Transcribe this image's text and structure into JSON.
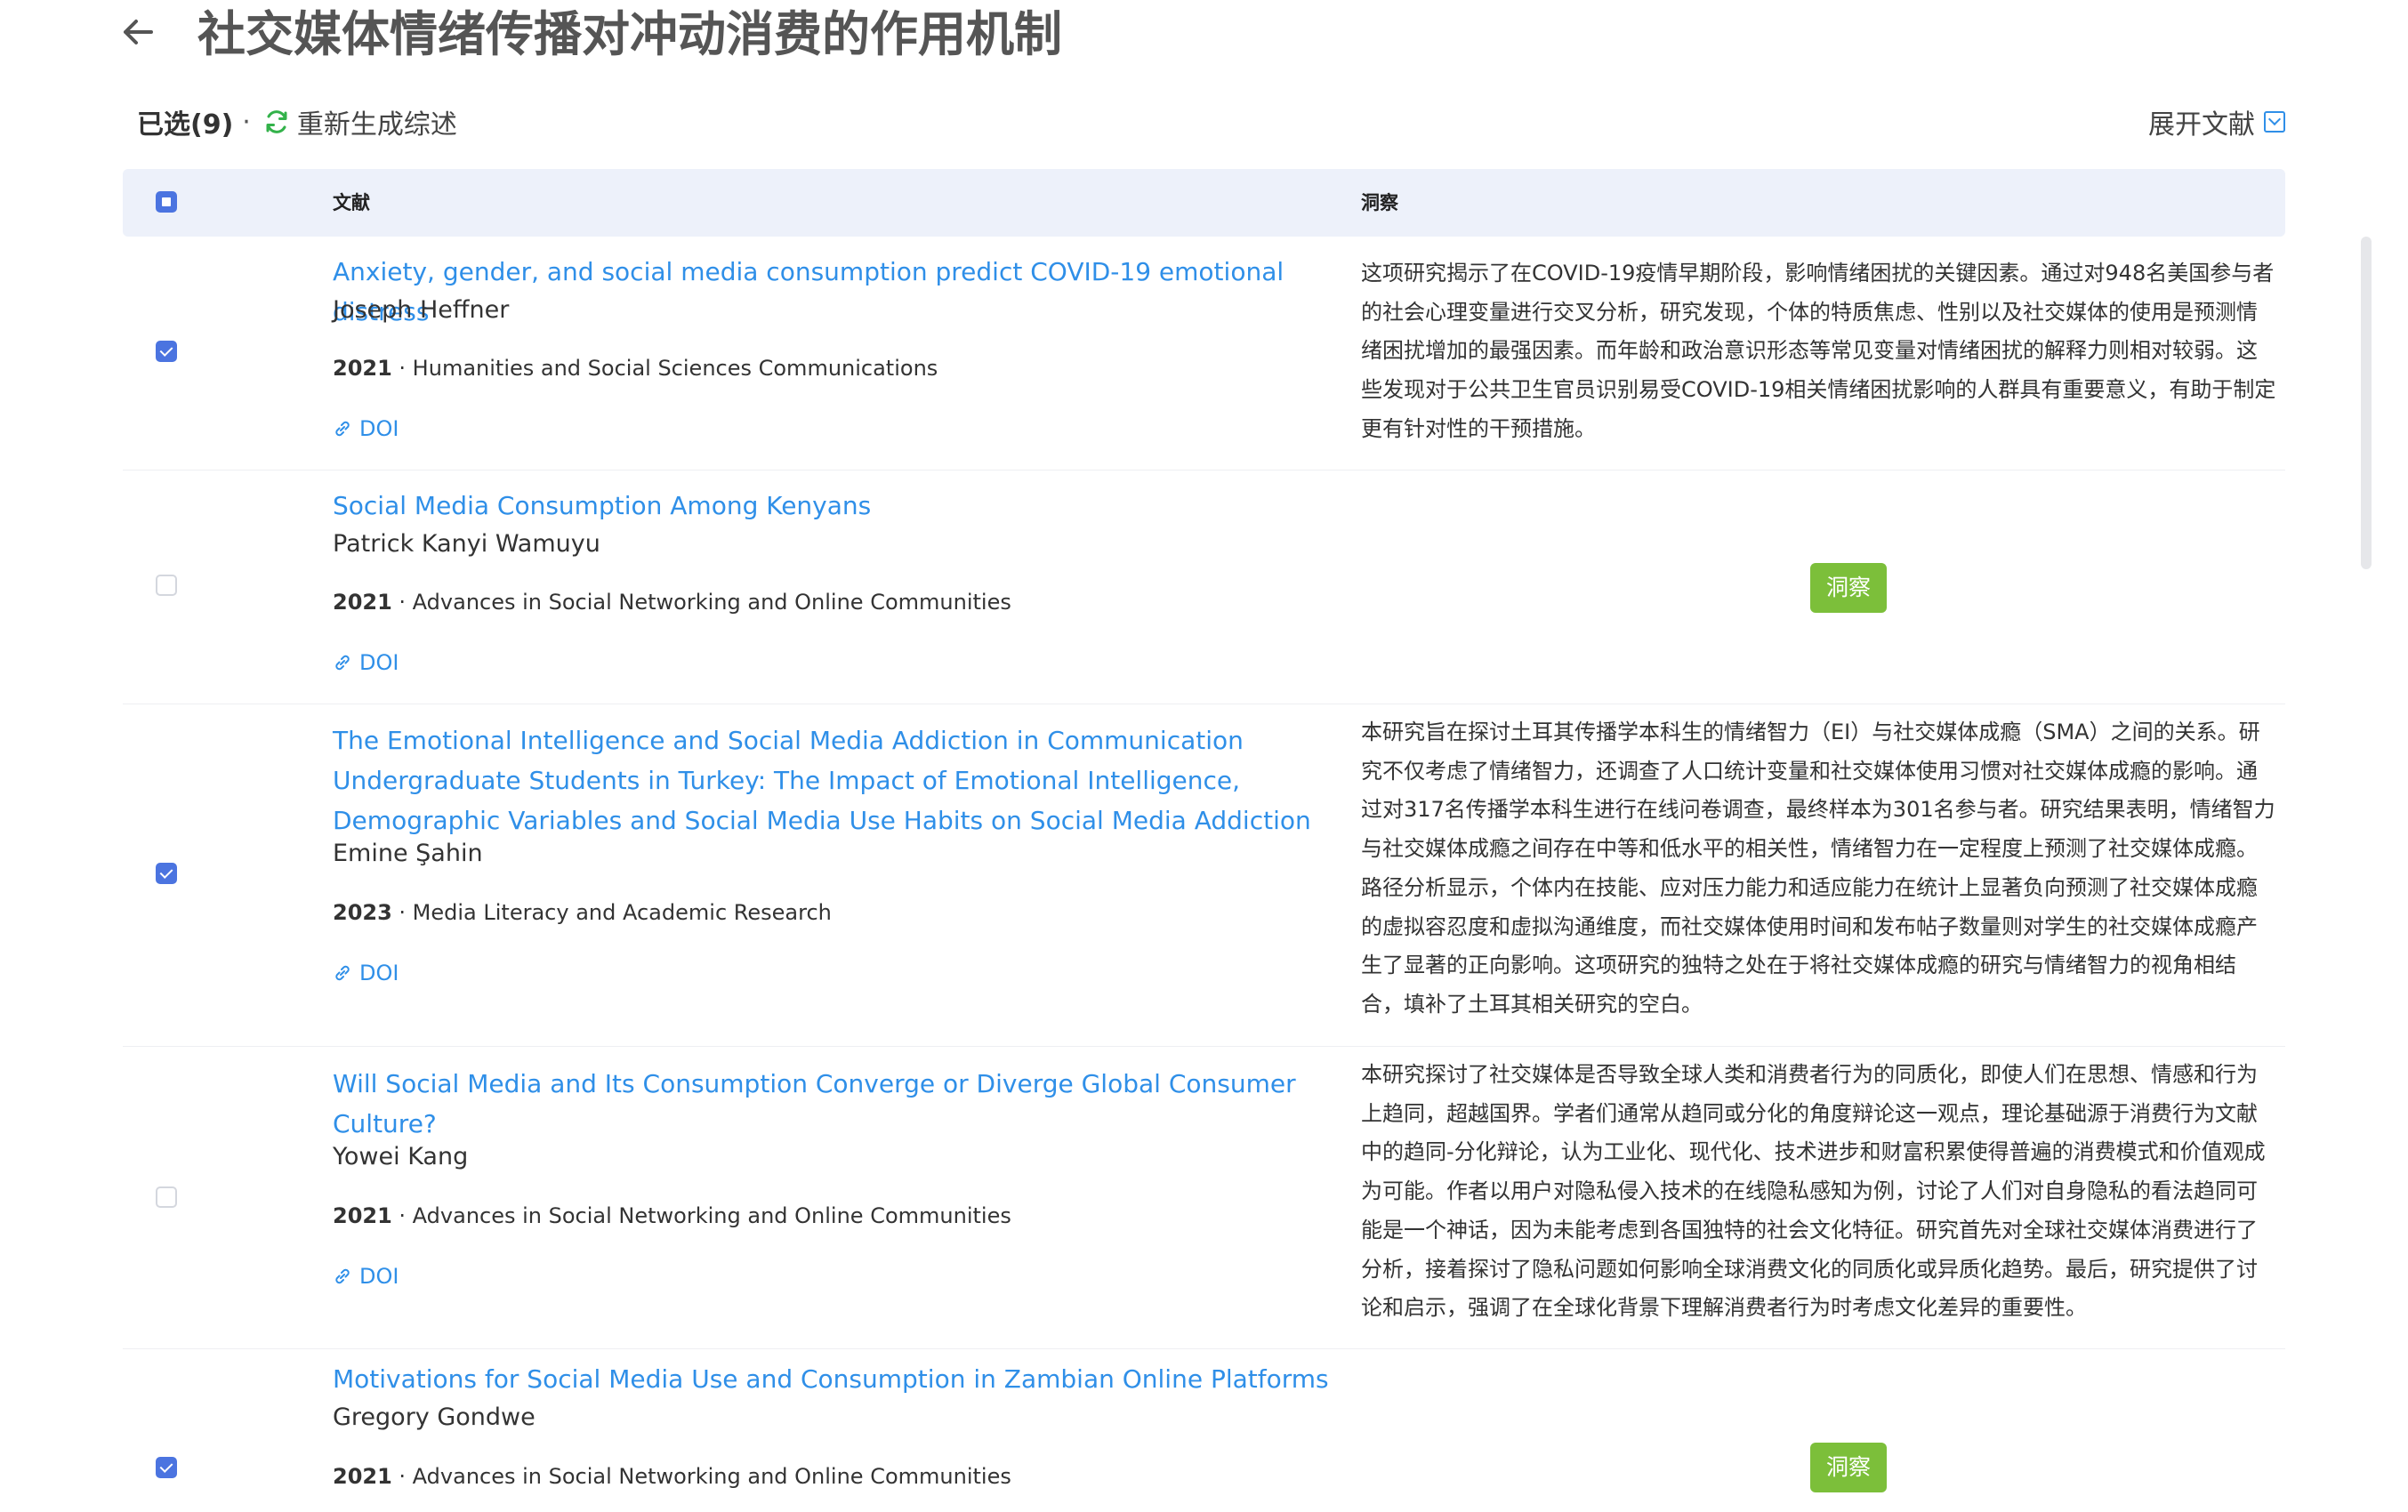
{
  "header": {
    "title": "社交媒体情绪传播对冲动消费的作用机制",
    "back_icon": "arrow-left-icon"
  },
  "toolbar": {
    "selected_label": "已选(9)",
    "separator": "·",
    "regenerate_label": "重新生成综述",
    "expand_label": "展开文献"
  },
  "table": {
    "columns": {
      "title": "文献",
      "insight": "洞察"
    },
    "header_checkbox_state": "indeterminate",
    "insight_button_label": "洞察",
    "doi_label": "DOI",
    "rows": [
      {
        "checked": true,
        "title": "Anxiety, gender, and social media consumption predict COVID-19 emotional distress",
        "author": "Joseph Heffner",
        "year": "2021",
        "venue": " · Humanities and Social Sciences Communications",
        "insight": "这项研究揭示了在COVID-19疫情早期阶段，影响情绪困扰的关键因素。通过对948名美国参与者的社会心理变量进行交叉分析，研究发现，个体的特质焦虑、性别以及社交媒体的使用是预测情绪困扰增加的最强因素。而年龄和政治意识形态等常见变量对情绪困扰的解释力则相对较弱。这些发现对于公共卫生官员识别易受COVID-19相关情绪困扰影响的人群具有重要意义，有助于制定更有针对性的干预措施。"
      },
      {
        "checked": false,
        "title": "Social Media Consumption Among Kenyans",
        "author": "Patrick Kanyi Wamuyu",
        "year": "2021",
        "venue": " · Advances in Social Networking and Online Communities",
        "insight": ""
      },
      {
        "checked": true,
        "title": "The Emotional Intelligence and Social Media Addiction in Communication Undergraduate Students in Turkey: The Impact of Emotional Intelligence, Demographic Variables and Social Media Use Habits on Social Media Addiction",
        "author": "Emine Şahin",
        "year": "2023",
        "venue": " · Media Literacy and Academic Research",
        "insight": "本研究旨在探讨土耳其传播学本科生的情绪智力（EI）与社交媒体成瘾（SMA）之间的关系。研究不仅考虑了情绪智力，还调查了人口统计变量和社交媒体使用习惯对社交媒体成瘾的影响。通过对317名传播学本科生进行在线问卷调查，最终样本为301名参与者。研究结果表明，情绪智力与社交媒体成瘾之间存在中等和低水平的相关性，情绪智力在一定程度上预测了社交媒体成瘾。路径分析显示，个体内在技能、应对压力能力和适应能力在统计上显著负向预测了社交媒体成瘾的虚拟容忍度和虚拟沟通维度，而社交媒体使用时间和发布帖子数量则对学生的社交媒体成瘾产生了显著的正向影响。这项研究的独特之处在于将社交媒体成瘾的研究与情绪智力的视角相结合，填补了土耳其相关研究的空白。"
      },
      {
        "checked": false,
        "title": "Will Social Media and Its Consumption Converge or Diverge Global Consumer Culture?",
        "author": "Yowei Kang",
        "year": "2021",
        "venue": " · Advances in Social Networking and Online Communities",
        "insight": "本研究探讨了社交媒体是否导致全球人类和消费者行为的同质化，即使人们在思想、情感和行为上趋同，超越国界。学者们通常从趋同或分化的角度辩论这一观点，理论基础源于消费行为文献中的趋同-分化辩论，认为工业化、现代化、技术进步和财富积累使得普遍的消费模式和价值观成为可能。作者以用户对隐私侵入技术的在线隐私感知为例，讨论了人们对自身隐私的看法趋同可能是一个神话，因为未能考虑到各国独特的社会文化特征。研究首先对全球社交媒体消费进行了分析，接着探讨了隐私问题如何影响全球消费文化的同质化或异质化趋势。最后，研究提供了讨论和启示，强调了在全球化背景下理解消费者行为时考虑文化差异的重要性。"
      },
      {
        "checked": true,
        "title": "Motivations for Social Media Use and Consumption in Zambian Online Platforms",
        "author": "Gregory Gondwe",
        "year": "2021",
        "venue": " · Advances in Social Networking and Online Communities",
        "insight": ""
      }
    ]
  },
  "colors": {
    "link": "#2f8fe8",
    "checkbox_checked": "#4b74e0",
    "insight_button": "#7cbf3a",
    "header_bg": "#edf1fa",
    "regenerate_icon": "#33b24a"
  }
}
